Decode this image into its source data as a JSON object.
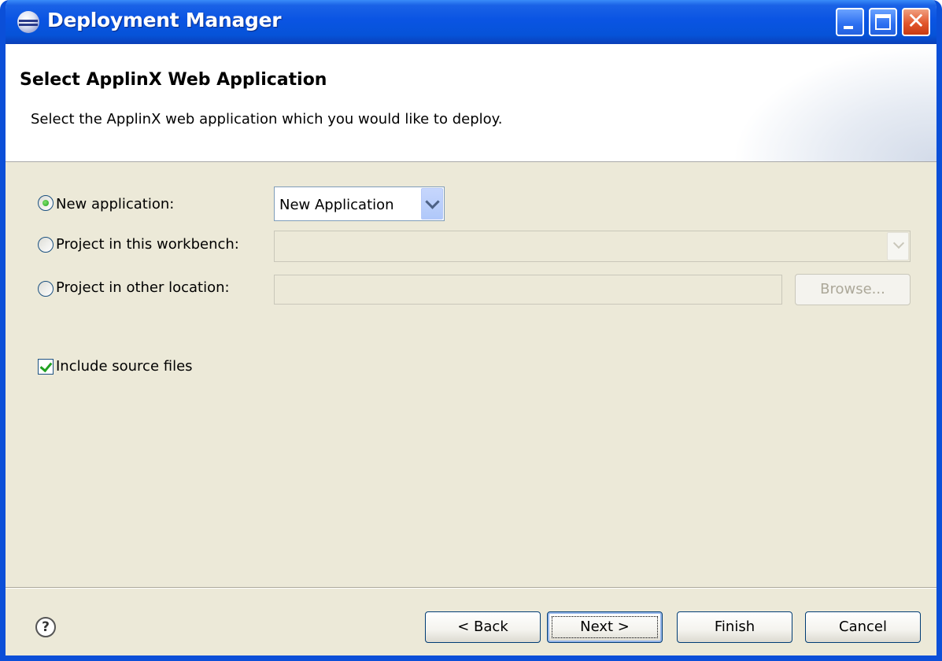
{
  "window": {
    "title": "Deployment Manager",
    "controls": {
      "minimize": "minimize",
      "maximize": "maximize",
      "close": "✕"
    }
  },
  "header": {
    "title": "Select ApplinX Web Application",
    "description": "Select the ApplinX web application which you would like to deploy."
  },
  "options": {
    "new_application": {
      "label": "New application:",
      "selected": true,
      "value": "New Application"
    },
    "project_workbench": {
      "label": "Project in this workbench:",
      "selected": false,
      "value": ""
    },
    "project_other": {
      "label": "Project in other location:",
      "selected": false,
      "value": "",
      "browse_label": "Browse..."
    }
  },
  "include_source": {
    "label": "Include source files",
    "checked": true
  },
  "footer": {
    "help_glyph": "?",
    "back_label": "< Back",
    "next_label": "Next >",
    "finish_label": "Finish",
    "cancel_label": "Cancel"
  }
}
